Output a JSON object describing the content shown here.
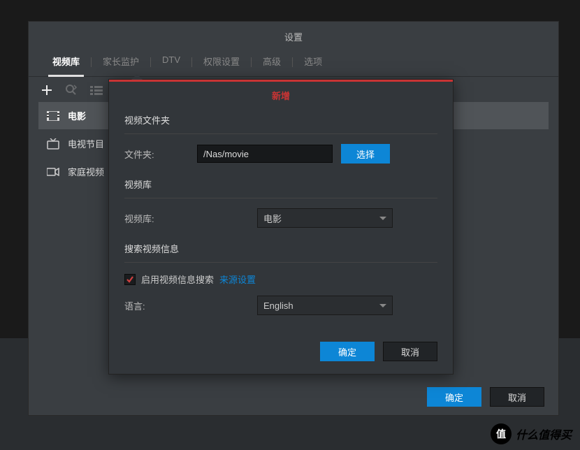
{
  "main": {
    "title": "设置",
    "tabs": [
      "视频库",
      "家长监护",
      "DTV",
      "权限设置",
      "高级",
      "选项"
    ],
    "active_tab": 0,
    "list": [
      {
        "label": "电影",
        "icon": "film"
      },
      {
        "label": "电视节目",
        "icon": "tv"
      },
      {
        "label": "家庭视频",
        "icon": "camera"
      }
    ],
    "active_item": 0,
    "footer": {
      "ok": "确定",
      "cancel": "取消"
    }
  },
  "modal": {
    "title": "新增",
    "section_folder": "视频文件夹",
    "folder_label": "文件夹:",
    "folder_value": "/Nas/movie",
    "choose_btn": "选择",
    "section_library": "视频库",
    "library_label": "视频库:",
    "library_value": "电影",
    "section_search": "搜索视频信息",
    "checkbox_checked": true,
    "checkbox_label": "启用视频信息搜索",
    "source_link": "来源设置",
    "language_label": "语言:",
    "language_value": "English",
    "footer": {
      "ok": "确定",
      "cancel": "取消"
    }
  },
  "watermark": {
    "badge": "值",
    "text": "什么值得买"
  }
}
